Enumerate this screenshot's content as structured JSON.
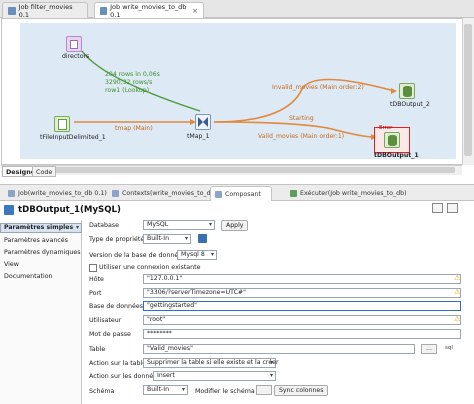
{
  "job_tabs": [
    {
      "label": "Job filter_movies 0.1"
    },
    {
      "label": "Job write_movies_to_db 0.1",
      "close": "×"
    }
  ],
  "canvas": {
    "components": {
      "directors": "directors",
      "input": "tFileInputDelimited_1",
      "tmap": "tMap_1",
      "output1": "tDBOutput_1",
      "output2": "tDBOutput_2"
    },
    "flows": {
      "lookup_stats": [
        "204 rows in 0,06s",
        "3290,32 rows/s",
        "row1 (Lookup)"
      ],
      "main": "tmap (Main)",
      "starting": "Starting",
      "invalid": "Invalid_movies (Main order:2)",
      "valid": "Valid_movies (Main order:1)"
    },
    "error_badge": "Error"
  },
  "designer_tabs": [
    "Designer",
    "Code"
  ],
  "panel_tabs": [
    "Job(write_movies_to_db 0.1)",
    "Contexts(write_movies_to_db)",
    "Composant",
    "Exécuter(Job write_movies_to_db)"
  ],
  "component_title": "tDBOutput_1(MySQL)",
  "nav": [
    "Paramètres simples",
    "Paramètres avancés",
    "Paramètres dynamiques",
    "View",
    "Documentation"
  ],
  "form": {
    "database_label": "Database",
    "database_value": "MySQL",
    "apply": "Apply",
    "property_type_label": "Type de propriété",
    "property_type_value": "Built-In",
    "db_version_label": "Version de la base de données",
    "db_version_value": "Mysql 8",
    "existing_conn_label": "Utiliser une connexion existante",
    "host_label": "Hôte",
    "host_value": "\"127.0.0.1\"",
    "port_label": "Port",
    "port_value": "\"3306/?serverTimezone=UTC#\"",
    "database_name_label": "Base de données",
    "database_name_value": "\"gettingstarted\"",
    "user_label": "Utilisateur",
    "user_value": "\"root\"",
    "password_label": "Mot de passe",
    "password_value": "********",
    "table_label": "Table",
    "table_value": "\"Valid_movies\"",
    "ellipsis": "...",
    "table_action_label": "Action sur la table",
    "table_action_value": "Supprimer la table si elle existe et la créer",
    "data_action_label": "Action sur les données",
    "data_action_value": "Insert",
    "schema_label": "Schéma",
    "schema_value": "Built-In",
    "edit_schema_label": "Modifier le schéma",
    "sync_columns": "Sync colonnes"
  }
}
